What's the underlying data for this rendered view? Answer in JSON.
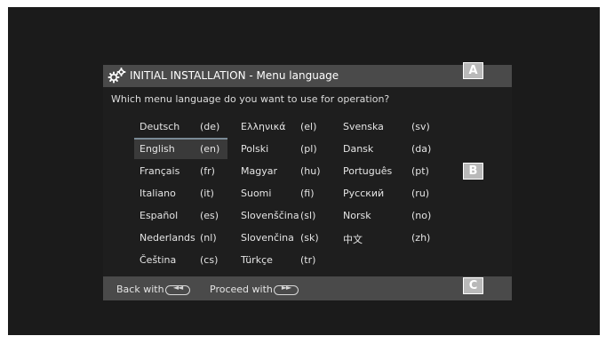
{
  "dialog": {
    "title": "INITIAL INSTALLATION - Menu language",
    "question": "Which menu language do you want to use for operation?"
  },
  "markers": {
    "a": "A",
    "b": "B",
    "c": "C"
  },
  "languages": [
    {
      "name": "Deutsch",
      "code": "(de)"
    },
    {
      "name": "English",
      "code": "(en)"
    },
    {
      "name": "Français",
      "code": "(fr)"
    },
    {
      "name": "Italiano",
      "code": "(it)"
    },
    {
      "name": "Español",
      "code": "(es)"
    },
    {
      "name": "Nederlands",
      "code": "(nl)"
    },
    {
      "name": "Čeština",
      "code": "(cs)"
    },
    {
      "name": "Ελληνικά",
      "code": "(el)"
    },
    {
      "name": "Polski",
      "code": "(pl)"
    },
    {
      "name": "Magyar",
      "code": "(hu)"
    },
    {
      "name": "Suomi",
      "code": "(fi)"
    },
    {
      "name": "Slovenščina",
      "code": "(sl)"
    },
    {
      "name": "Slovenčina",
      "code": "(sk)"
    },
    {
      "name": "Türkçe",
      "code": "(tr)"
    },
    {
      "name": "Svenska",
      "code": "(sv)"
    },
    {
      "name": "Dansk",
      "code": "(da)"
    },
    {
      "name": "Português",
      "code": "(pt)"
    },
    {
      "name": "Русский",
      "code": "(ru)"
    },
    {
      "name": "Norsk",
      "code": "(no)"
    },
    {
      "name": "中文",
      "code": "(zh)"
    }
  ],
  "selected_language": "English",
  "footer": {
    "back_label": "Back with",
    "back_key": "◄◄",
    "proceed_label": "Proceed with",
    "proceed_key": "►►"
  },
  "colors": {
    "screen_bg": "#1b1b1b",
    "bar_bg": "#4a4a4a",
    "marker_bg": "#b9b9b9",
    "selection_accent": "#7a8a96"
  }
}
